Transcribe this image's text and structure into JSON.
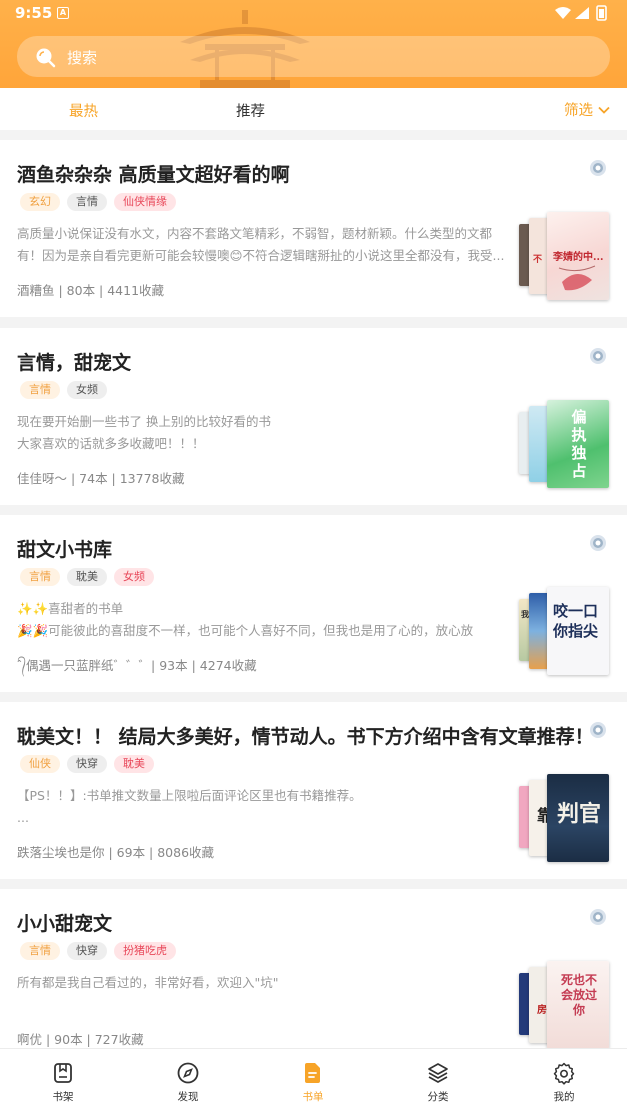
{
  "status": {
    "time": "9:55"
  },
  "search": {
    "placeholder": "搜索"
  },
  "tabs": [
    {
      "label": "最热",
      "active": true
    },
    {
      "label": "推荐",
      "active": false
    }
  ],
  "filter": {
    "label": "筛选"
  },
  "booklists": [
    {
      "title": "酒鱼杂杂杂 高质量文超好看的啊",
      "tags": [
        {
          "text": "玄幻",
          "color": "orange"
        },
        {
          "text": "言情",
          "color": "gray"
        },
        {
          "text": "仙侠情缘",
          "color": "pink"
        }
      ],
      "desc": "高质量小说保证没有水文，内容不套路文笔精彩，不弱智，题材新颖。什么类型的文都有！因为是亲自看完更新可能会较慢噢😊不符合逻辑瞎掰扯的小说这里全都没有，我受...",
      "meta": "酒糟鱼 | 80本 | 4411收藏",
      "cover_text": "李婧的中...",
      "cover_text_small": "不"
    },
    {
      "title": "言情，甜宠文",
      "tags": [
        {
          "text": "言情",
          "color": "orange"
        },
        {
          "text": "女频",
          "color": "gray"
        }
      ],
      "desc": "现在要开始删一些书了 换上别的比较好看的书\n大家喜欢的话就多多收藏吧！！！",
      "meta": "佳佳呀～ | 74本 | 13778收藏",
      "cover_text": "偏执独占",
      "cover_text_small": ""
    },
    {
      "title": "甜文小书库",
      "tags": [
        {
          "text": "言情",
          "color": "orange"
        },
        {
          "text": "耽美",
          "color": "gray"
        },
        {
          "text": "女频",
          "color": "pink"
        }
      ],
      "desc": "✨✨喜甜者的书单\n🎉🎉可能彼此的喜甜度不一样，也可能个人喜好不同，但我也是用了心的，放心放心，...",
      "meta": "ˆ᭄偶遇一只蓝胖纸゛゛゛| 93本 | 4274收藏",
      "cover_text": "咬一口你指尖",
      "cover_text_small": "我"
    },
    {
      "title": "耽美文！！ 结局大多美好，情节动人。书下方介绍中含有文章推荐！",
      "tags": [
        {
          "text": "仙侠",
          "color": "orange"
        },
        {
          "text": "快穿",
          "color": "gray"
        },
        {
          "text": "耽美",
          "color": "pink"
        }
      ],
      "desc": "【PS！！】:书单推文数量上限啦后面评论区里也有书籍推荐。\n...",
      "meta": "跌落尘埃也是你 | 69本 | 8086收藏",
      "cover_text": "判官",
      "cover_text_small": "靠"
    },
    {
      "title": "小小甜宠文",
      "tags": [
        {
          "text": "言情",
          "color": "orange"
        },
        {
          "text": "快穿",
          "color": "gray"
        },
        {
          "text": "扮猪吃虎",
          "color": "pink"
        }
      ],
      "desc": "所有都是我自己看过的，非常好看，欢迎入\"坑\"",
      "meta": "啊优 | 90本 | 727收藏",
      "cover_text": "死也不会放过你",
      "cover_text_small": "房"
    }
  ],
  "bottom_nav": [
    {
      "label": "书架",
      "icon": "bookshelf-icon",
      "active": false
    },
    {
      "label": "发现",
      "icon": "compass-icon",
      "active": false
    },
    {
      "label": "书单",
      "icon": "booklist-icon",
      "active": true
    },
    {
      "label": "分类",
      "icon": "layers-icon",
      "active": false
    },
    {
      "label": "我的",
      "icon": "gear-icon",
      "active": false
    }
  ],
  "colors": {
    "accent": "#f7a428",
    "header": "#ffa53a"
  }
}
